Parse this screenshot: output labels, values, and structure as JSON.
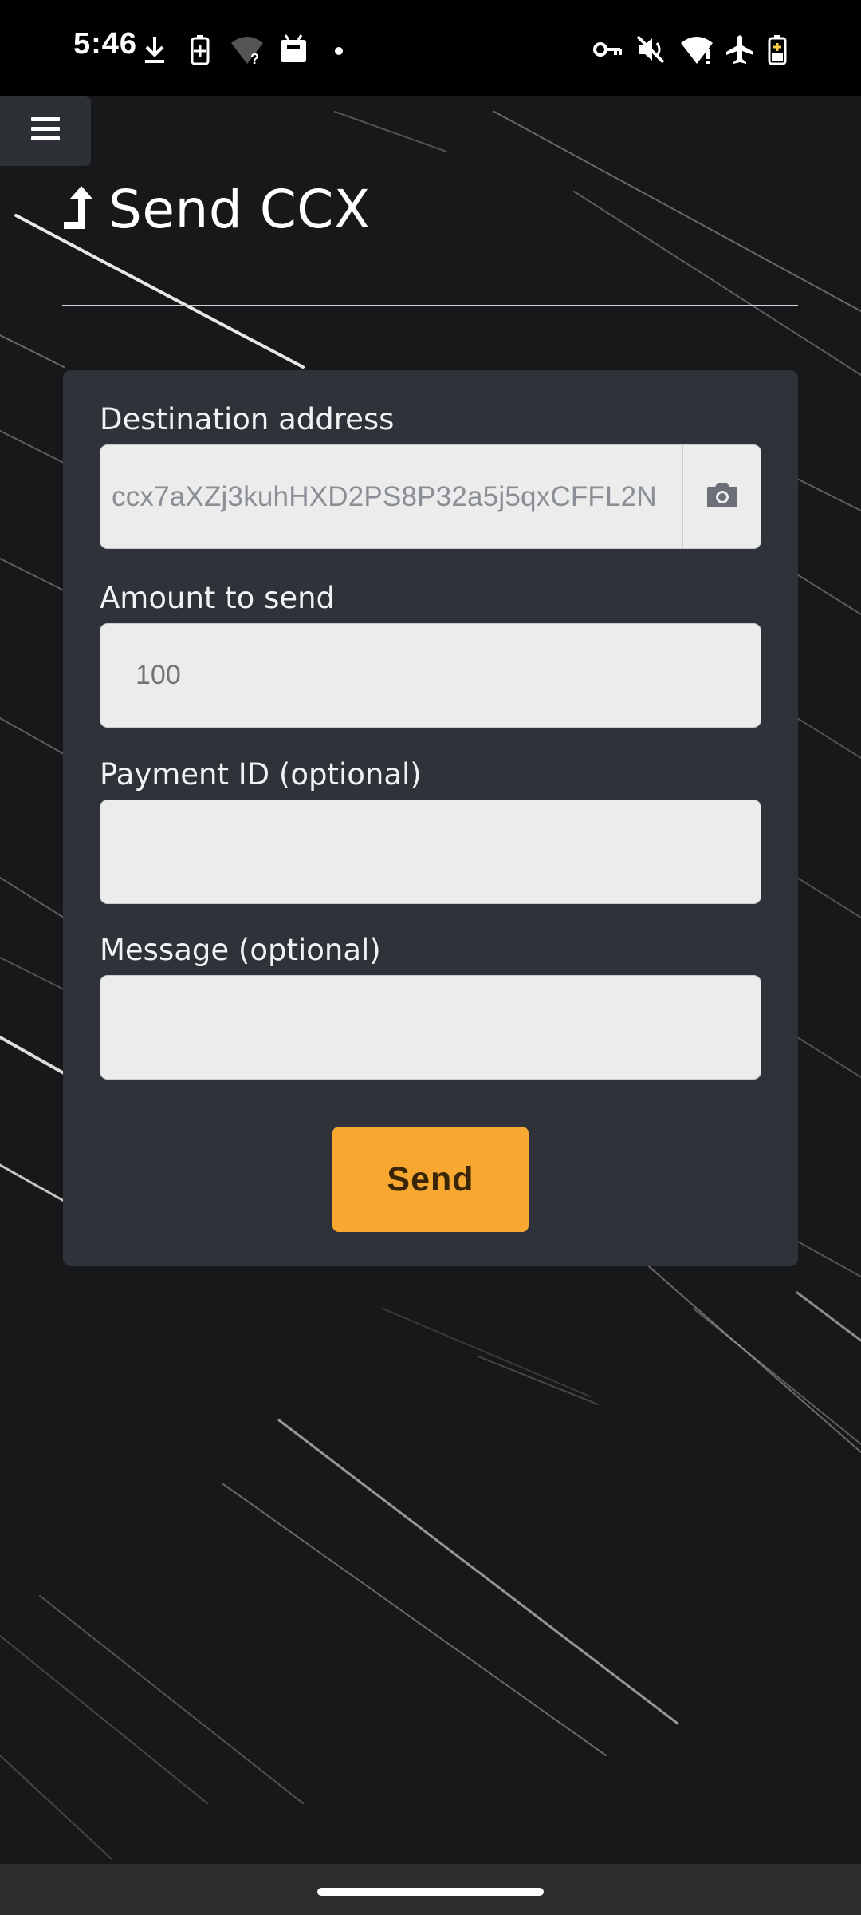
{
  "status_bar": {
    "time": "5:46",
    "left_icons": [
      "download-icon",
      "battery-saver-icon",
      "wifi-unknown-icon",
      "app-icon",
      "dot-icon"
    ],
    "right_icons": [
      "vpn-key-icon",
      "mute-icon",
      "wifi-alert-icon",
      "airplane-icon",
      "battery-icon"
    ]
  },
  "header": {
    "menu_icon": "hamburger-menu-icon",
    "title_icon": "upload-arrow-icon",
    "title": "Send CCX"
  },
  "form": {
    "destination": {
      "label": "Destination address",
      "value": "ccx7aXZj3kuhHXD2PS8P32a5j5qxCFFL2N",
      "scan_icon": "camera-icon"
    },
    "amount": {
      "label": "Amount to send",
      "placeholder": "100"
    },
    "payment_id": {
      "label": "Payment ID (optional)",
      "placeholder": ""
    },
    "message": {
      "label": "Message (optional)",
      "placeholder": ""
    },
    "send_label": "Send"
  },
  "colors": {
    "background": "#17181a",
    "card": "#2f3238",
    "input": "#ececec",
    "accent": "#f8a831"
  }
}
